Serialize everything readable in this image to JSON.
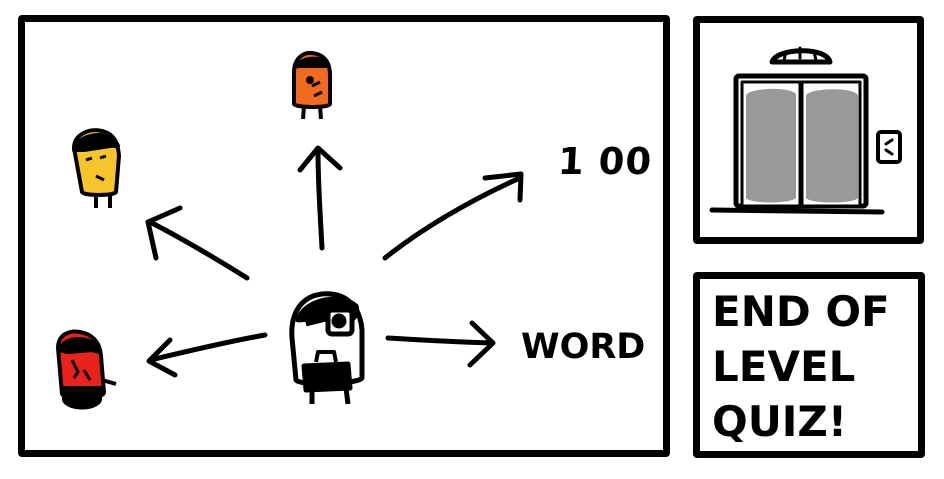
{
  "main": {
    "score": "1 00",
    "word_label": "WORD"
  },
  "characters": {
    "center": {
      "name": "player-with-eyepatch",
      "color": "#ffffff"
    },
    "top": {
      "color": "#f26a1d"
    },
    "upper_left": {
      "color": "#f5c52b"
    },
    "lower_left": {
      "color": "#e8231c"
    }
  },
  "elevator": {
    "door_color": "#999999",
    "icon": "elevator-icon"
  },
  "quiz": {
    "line1": "END OF",
    "line2": "LEVEL",
    "line3": "QUIZ!"
  }
}
